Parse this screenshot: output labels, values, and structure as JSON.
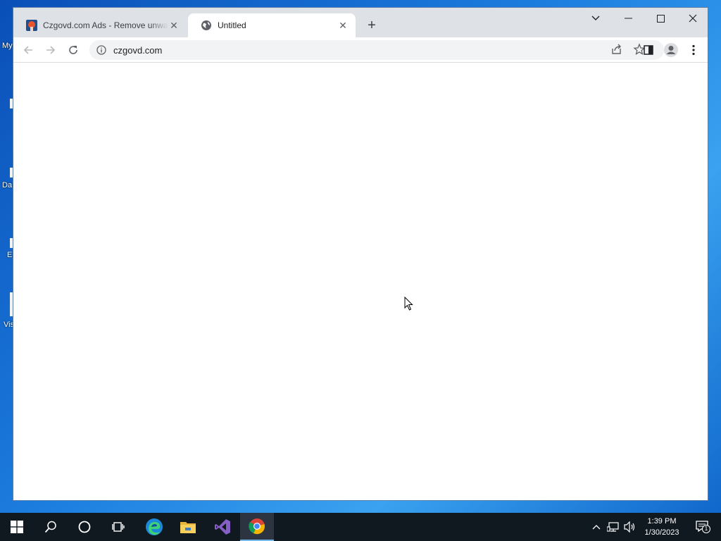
{
  "desktop": {
    "icons": [
      {
        "label": "My"
      },
      {
        "label": "Da"
      },
      {
        "label": "E"
      },
      {
        "label": "Vis"
      }
    ]
  },
  "browser": {
    "tabs": [
      {
        "title": "Czgovd.com Ads - Remove unwanted",
        "favicon": "pcrisk-icon",
        "active": false
      },
      {
        "title": "Untitled",
        "favicon": "globe-icon",
        "active": true
      }
    ],
    "address": "czgovd.com",
    "accent": "#1a73e8"
  },
  "taskbar": {
    "apps": [
      "start",
      "search",
      "cortana",
      "task-view",
      "edge",
      "file-explorer",
      "visual-studio",
      "chrome"
    ],
    "active_app": "chrome",
    "clock": {
      "time": "1:39 PM",
      "date": "1/30/2023"
    },
    "notification_count": "1"
  }
}
